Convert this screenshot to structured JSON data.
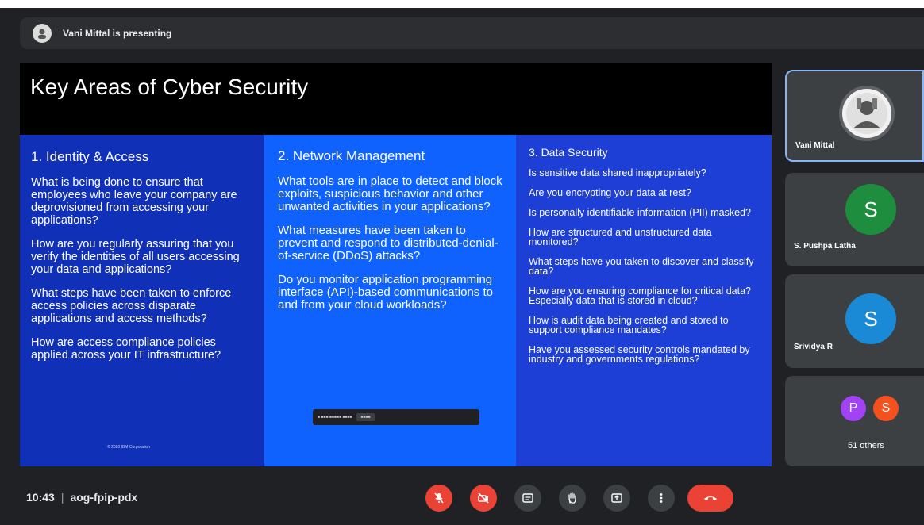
{
  "presenter": {
    "text": "Vani Mittal is presenting"
  },
  "slide": {
    "title": "Key Areas of Cyber Security",
    "columns": [
      {
        "heading": "1. Identity & Access",
        "questions": [
          "What is being done to ensure that employees who leave your company are deprovisioned from accessing your applications?",
          "How are you regularly assuring that you verify the identities of all users accessing your data and applications?",
          "What steps have been taken to enforce access policies across disparate applications and access methods?",
          "How are access compliance policies applied across your IT infrastructure?"
        ]
      },
      {
        "heading": "2. Network Management",
        "questions": [
          "What tools are in place to detect and block exploits, suspicious behavior and other unwanted activities in your applications?",
          "What measures have been taken to prevent and respond to distributed-denial-of-service (DDoS) attacks?",
          "Do you monitor application programming interface (API)-based communications to and from your cloud workloads?"
        ]
      },
      {
        "heading": "3. Data Security",
        "questions": [
          "Is sensitive data shared inappropriately?",
          "Are you encrypting your data at rest?",
          "Is personally identifiable information (PII) masked?",
          "How are structured and unstructured data monitored?",
          "What steps have you taken to discover and classify data?",
          "How are you ensuring compliance for critical data? Especially data that is stored in cloud?",
          "How is audit data being created and stored to support compliance mandates?",
          "Have you assessed security controls mandated by industry and governments regulations?"
        ]
      }
    ],
    "footnote": "© 2020 IBM Corporation"
  },
  "participants": [
    {
      "name": "Vani Mittal",
      "type": "photo"
    },
    {
      "name": "S. Pushpa Latha",
      "initial": "S",
      "color": "#1e8e3e"
    },
    {
      "name": "Srividya R",
      "initial": "S",
      "color": "#1a8ad6"
    }
  ],
  "others": {
    "avatars": [
      {
        "initial": "P",
        "color": "#a142f4"
      },
      {
        "initial": "S",
        "color": "#f4511e"
      }
    ],
    "count": "51 others"
  },
  "meeting": {
    "time": "10:43",
    "separator": "|",
    "code": "aog-fpip-pdx"
  },
  "controls": [
    "mic-off-icon",
    "camera-off-icon",
    "captions-icon",
    "raise-hand-icon",
    "present-icon",
    "more-icon",
    "leave-call-icon"
  ]
}
